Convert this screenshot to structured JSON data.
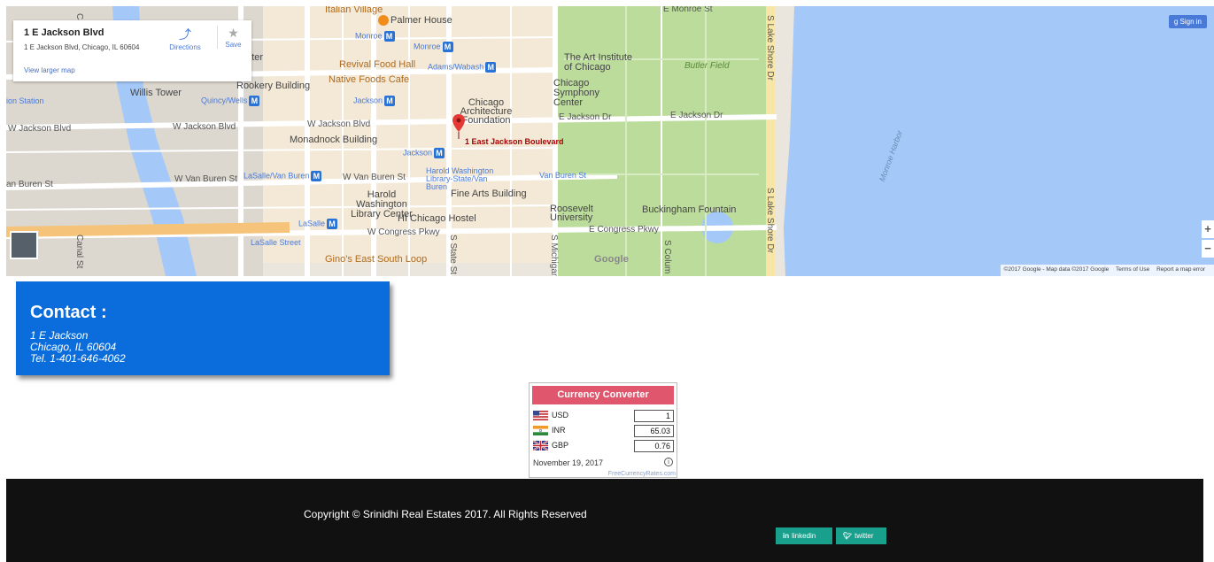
{
  "map": {
    "info_card": {
      "title": "1 E Jackson Blvd",
      "address": "1 E Jackson Blvd, Chicago, IL 60604",
      "directions_label": "Directions",
      "save_label": "Save",
      "view_larger_label": "View larger map"
    },
    "sign_in_label": "Sign in",
    "zoom_in_label": "+",
    "zoom_out_label": "−",
    "google_logo": "Google",
    "pin_label": "1 East Jackson Boulevard",
    "footer": {
      "copyright": "©2017 Google - Map data ©2017 Google",
      "terms": "Terms of Use",
      "report": "Report a map error"
    },
    "labels": {
      "italian_village": "Italian Village",
      "palmer_house": "Palmer House",
      "monroe1": "Monroe",
      "monroe2": "Monroe",
      "revival": "Revival Food Hall",
      "adams": "Adams/Wabash",
      "art_institute": "The Art Institute of Chicago",
      "butler": "Butler Field",
      "center": "enter",
      "rookery": "Rookery Building",
      "native": "Native Foods Cafe",
      "willis": "Willis Tower",
      "quincy": "Quincy/Wells",
      "jackson_metro": "Jackson",
      "symphony": "Chicago Symphony Center",
      "arch_foundation": "Chicago Architecture Foundation",
      "union_station": "ion Station",
      "w_jackson1": "W Jackson Blvd",
      "w_jackson2": "W Jackson Blvd",
      "w_jackson3": "W Jackson Blvd",
      "e_jackson1": "E Jackson Dr",
      "e_jackson2": "E Jackson Dr",
      "monadnock": "Monadnock Building",
      "jackson2": "Jackson",
      "van_buren1": "an Buren St",
      "van_buren2": "W Van Buren St",
      "van_buren3": "W Van Buren St",
      "lasalle_vb": "LaSalle/Van Buren",
      "harold_lib": "Harold Washington Library-State/Van Buren",
      "van_buren_st": "Van Buren St",
      "harold_center": "Harold Washington Library Center",
      "fine_arts": "Fine Arts Building",
      "roosevelt": "Roosevelt University",
      "buckingham": "Buckingham Fountain",
      "lasalle": "LaSalle",
      "hi_hostel": "HI Chicago Hostel",
      "w_congress": "W Congress Pkwy",
      "e_congress": "E Congress Pkwy",
      "lasalle_street": "LaSalle Street",
      "ginos": "Gino's East South Loop",
      "lake_shore1": "S Lake Shore Dr",
      "lake_shore2": "S Lake Shore Dr",
      "monroe_harbor": "Monroe Harbor",
      "e_monroe": "E Monroe St",
      "canal1": "Canal St",
      "canal2": "Canal St",
      "state": "S State St",
      "michigan": "S Michigan",
      "columbus": "S Colum"
    }
  },
  "contact": {
    "title": "Contact :",
    "line1": "1 E Jackson",
    "line2": "Chicago, IL 60604",
    "line3": "Tel. 1-401-646-4062"
  },
  "currency": {
    "title": "Currency Converter",
    "rows": [
      {
        "code": "USD",
        "value": "1"
      },
      {
        "code": "INR",
        "value": "65.03"
      },
      {
        "code": "GBP",
        "value": "0.76"
      }
    ],
    "date": "November 19, 2017",
    "info_icon": "i",
    "source": "FreeCurrencyRates.com"
  },
  "footer": {
    "copyright": "Copyright © Srinidhi Real Estates 2017. All Rights Reserved",
    "linkedin_icon": "in",
    "linkedin_label": "linkedin",
    "twitter_icon": "✔",
    "twitter_label": "twitter"
  },
  "colors": {
    "contact_bg": "#0a6ddb",
    "currency_head": "#e0566d",
    "footer_bg": "#111111",
    "social_btn": "#19a08c",
    "water": "#a4c8f8",
    "park": "#bcdc9c"
  }
}
